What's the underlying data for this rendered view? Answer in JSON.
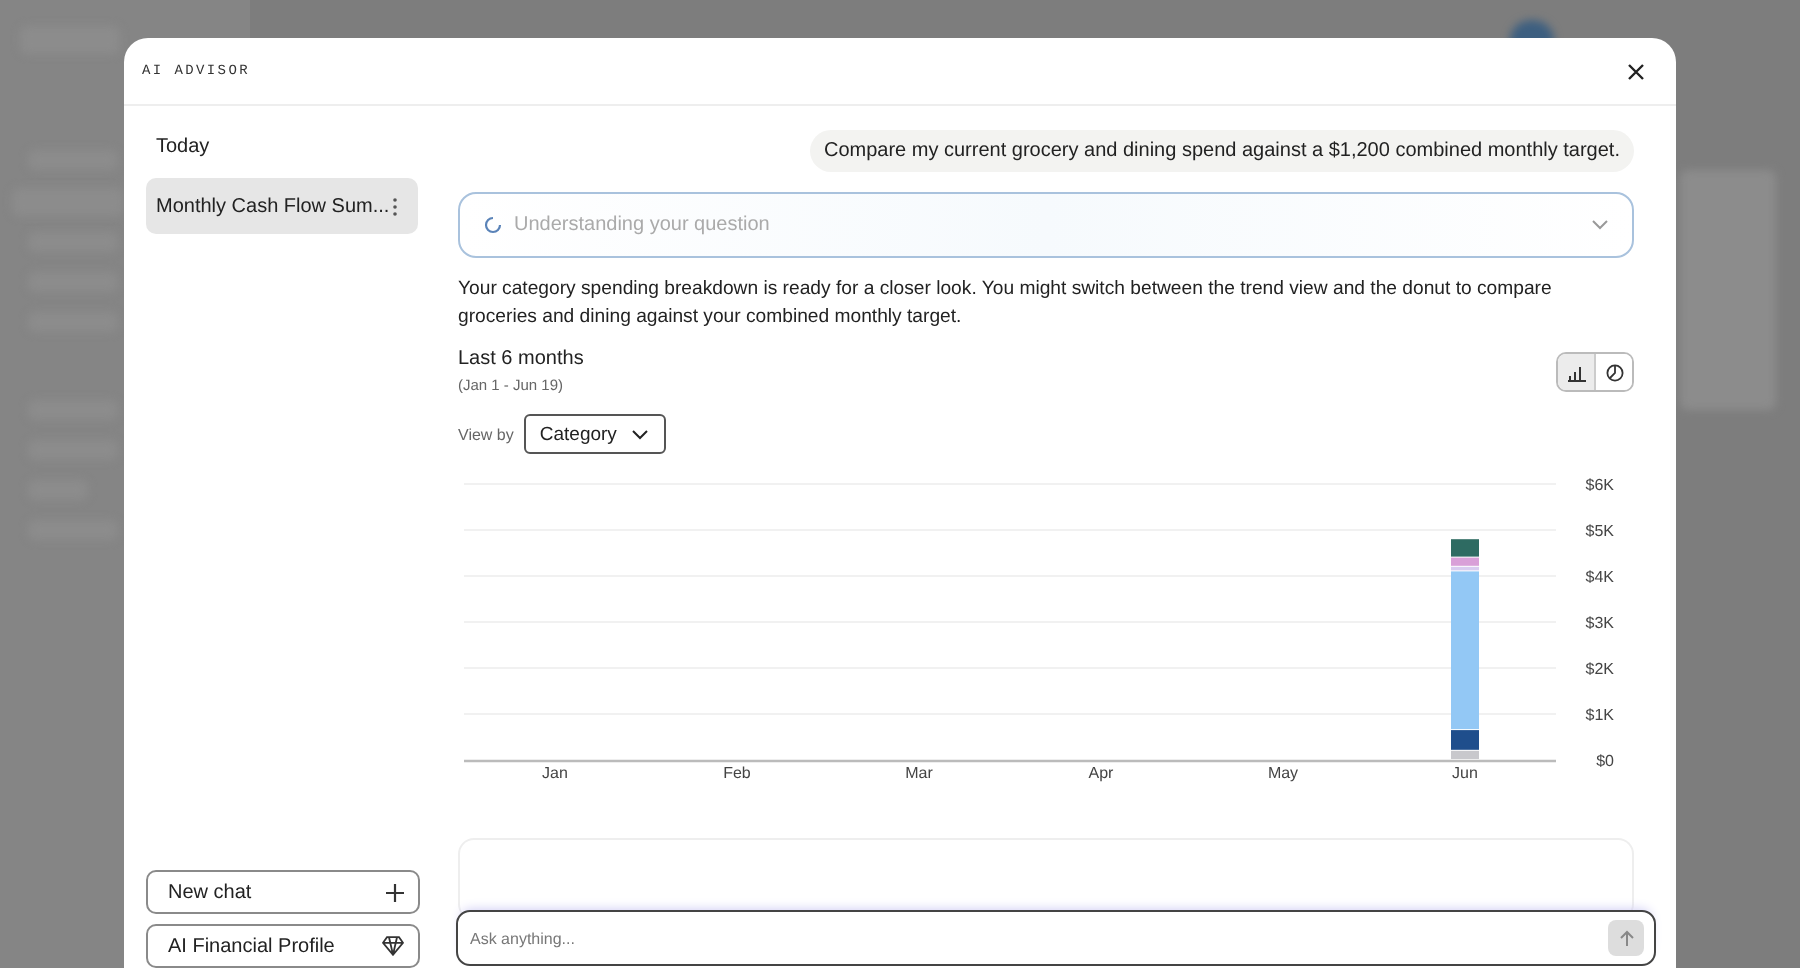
{
  "dialog": {
    "title": "AI ADVISOR"
  },
  "sidebar": {
    "group": "Today",
    "chats": [
      {
        "title": "Monthly Cash Flow Sum...",
        "selected": true
      }
    ],
    "buttons": [
      {
        "label": "New chat",
        "kind": "new"
      },
      {
        "label": "AI Financial Profile",
        "kind": "profile"
      }
    ]
  },
  "conversation": {
    "user_message": "Compare my current grocery and dining spend against a $1,200 combined monthly target.",
    "status": "Understanding your question",
    "answer": "Your category spending breakdown is ready for a closer look. You might switch between the trend view and the donut to compare groceries and dining against your combined monthly target.",
    "range": {
      "title": "Last 6 months",
      "dates": "(Jan 1 - Jun 19)"
    },
    "views": [
      {
        "kind": "bar",
        "selected": true
      },
      {
        "kind": "donut",
        "selected": false
      }
    ],
    "view_by": {
      "label": "View by",
      "value": "Category"
    },
    "chart_data": {
      "type": "bar",
      "stacked": true,
      "grid": true,
      "categories": [
        "Jan",
        "Feb",
        "Mar",
        "Apr",
        "May",
        "Jun"
      ],
      "series": [
        {
          "color": "#c8c8cc",
          "values": [
            0,
            0,
            0,
            0,
            0,
            200
          ]
        },
        {
          "color": "#1f4e8c",
          "values": [
            0,
            0,
            0,
            0,
            0,
            450
          ]
        },
        {
          "color": "#93c8f5",
          "values": [
            0,
            0,
            0,
            0,
            0,
            3450
          ]
        },
        {
          "color": "#d8ccf0",
          "values": [
            0,
            0,
            0,
            0,
            0,
            100
          ]
        },
        {
          "color": "#d9a0d8",
          "values": [
            0,
            0,
            0,
            0,
            0,
            200
          ]
        },
        {
          "color": "#2e6b62",
          "values": [
            0,
            0,
            0,
            0,
            0,
            400
          ]
        }
      ],
      "ylim": [
        0,
        6000
      ],
      "yticks": [
        {
          "value": 0,
          "label": "$0"
        },
        {
          "value": 1000,
          "label": "$1K"
        },
        {
          "value": 2000,
          "label": "$2K"
        },
        {
          "value": 3000,
          "label": "$3K"
        },
        {
          "value": 4000,
          "label": "$4K"
        },
        {
          "value": 5000,
          "label": "$5K"
        },
        {
          "value": 6000,
          "label": "$6K"
        }
      ]
    },
    "input": {
      "placeholder": "Ask anything..."
    }
  }
}
